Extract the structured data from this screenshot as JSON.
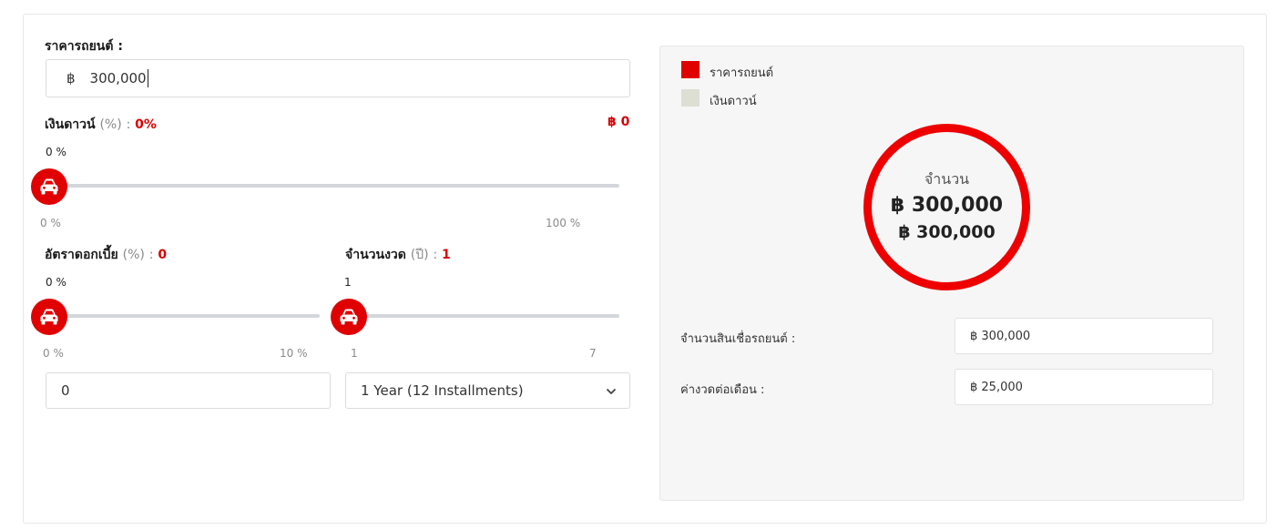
{
  "car_price": {
    "label": "ราคารถยนต์ :",
    "currency_symbol": "฿",
    "value": "300,000"
  },
  "down_payment": {
    "label": "เงินดาวน์",
    "unit": "(%)",
    "sep": ":",
    "percent_text": "0%",
    "amount_text": "฿ 0",
    "slider_value": "0 %",
    "min_label": "0 %",
    "max_label": "100 %",
    "fraction": 0.0
  },
  "interest": {
    "label": "อัตราดอกเบี้ย",
    "unit": "(%)",
    "sep": ":",
    "value_text": "0",
    "slider_value": "0 %",
    "min_label": "0 %",
    "max_label": "10 %",
    "input_value": "0",
    "fraction": 0.0
  },
  "installments": {
    "label": "จำนวนงวด",
    "unit": "(ปี)",
    "sep": ":",
    "value_text": "1",
    "slider_value": "1",
    "min_label": "1",
    "max_label": "7",
    "select_value": "1 Year (12 Installments)",
    "fraction": 0.0
  },
  "legend": [
    {
      "label": "ราคารถยนต์",
      "color": "#e00000"
    },
    {
      "label": "เงินดาวน์",
      "color": "#dedfd3"
    }
  ],
  "donut": {
    "title": "จำนวน",
    "value_primary": "฿ 300,000",
    "value_secondary": "฿ 300,000",
    "color": "#ef0000"
  },
  "results": {
    "loan_label": "จำนวนสินเชื่อรถยนต์ :",
    "loan_value": "฿ 300,000",
    "monthly_label": "ค่างวดต่อเดือน :",
    "monthly_value": "฿ 25,000"
  },
  "icons": {
    "slider_knob": "car-icon",
    "select": "chevron-down-icon"
  }
}
